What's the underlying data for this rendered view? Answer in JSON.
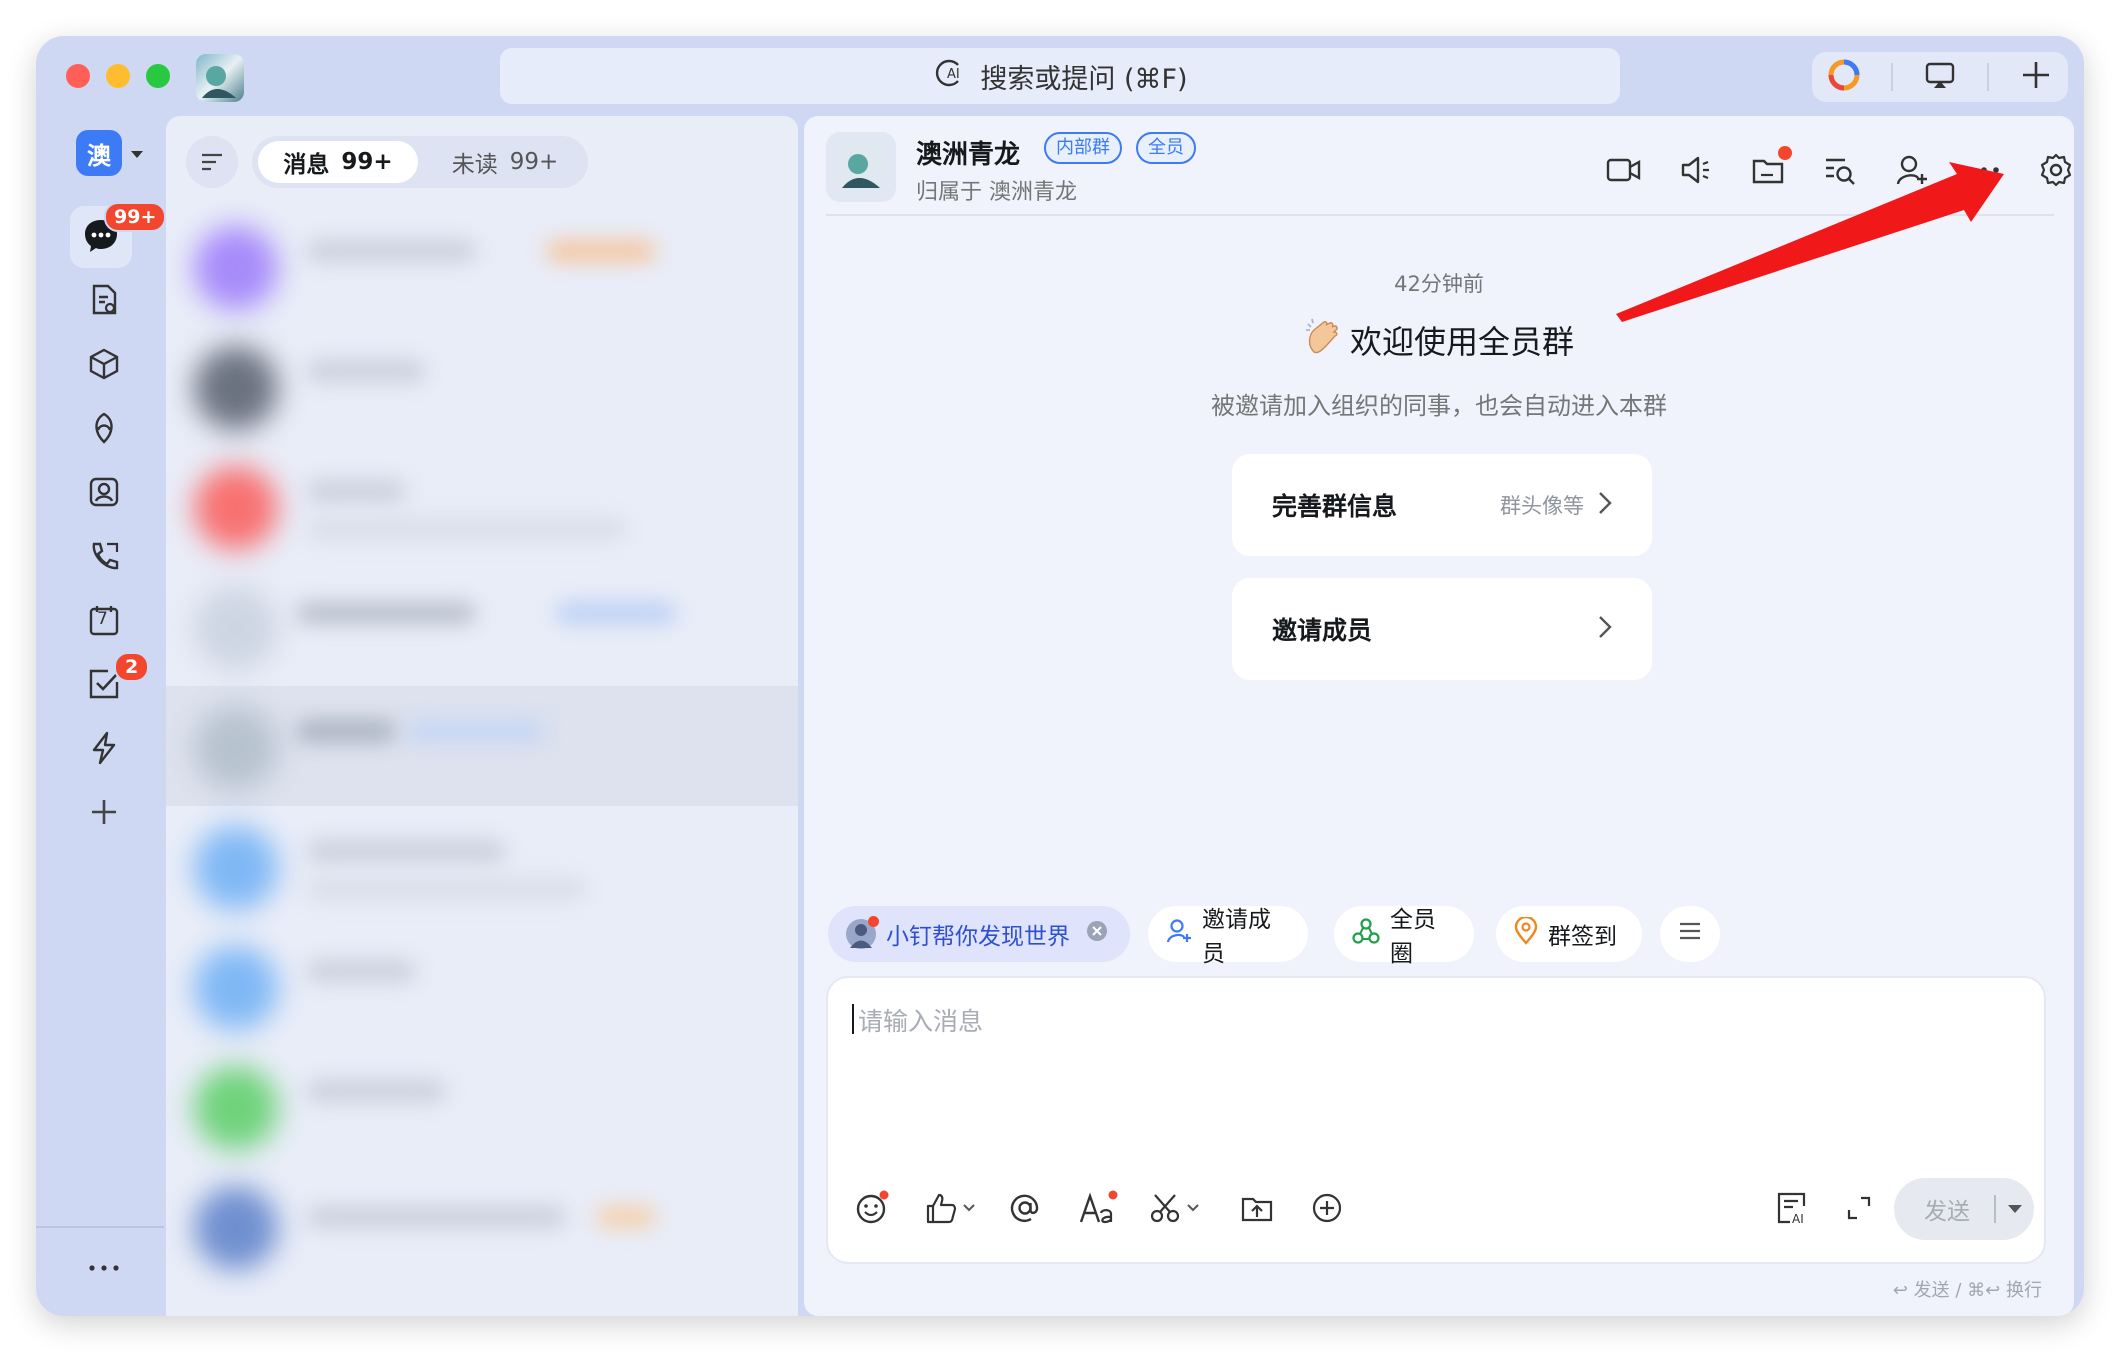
{
  "titlebar": {
    "search_placeholder": "搜索或提问 (⌘F)"
  },
  "org": {
    "avatar_char": "澳"
  },
  "rail": {
    "messages_badge": "99+",
    "todo_badge": "2",
    "calendar_day": "7"
  },
  "list": {
    "tab_messages_label": "消息",
    "tab_messages_count": "99+",
    "tab_unread_label": "未读",
    "tab_unread_count": "99+"
  },
  "chat": {
    "group_name": "澳洲青龙",
    "tag_internal": "内部群",
    "tag_all": "全员",
    "subtitle": "归属于 澳洲青龙",
    "timestamp": "42分钟前",
    "welcome_title": "欢迎使用全员群",
    "welcome_desc": "被邀请加入组织的同事，也会自动进入本群",
    "card1_label": "完善群信息",
    "card1_hint": "群头像等",
    "card2_label": "邀请成员"
  },
  "chips": {
    "assistant": "小钉帮你发现世界",
    "invite": "邀请成员",
    "circle": "全员圈",
    "checkin": "群签到"
  },
  "composer": {
    "placeholder": "请输入消息",
    "send_label": "发送",
    "hint": "↩ 发送 / ⌘↩ 换行"
  },
  "colors": {
    "accent": "#3d7af5",
    "badge": "#f2462e",
    "annotation_arrow": "#f01818"
  }
}
